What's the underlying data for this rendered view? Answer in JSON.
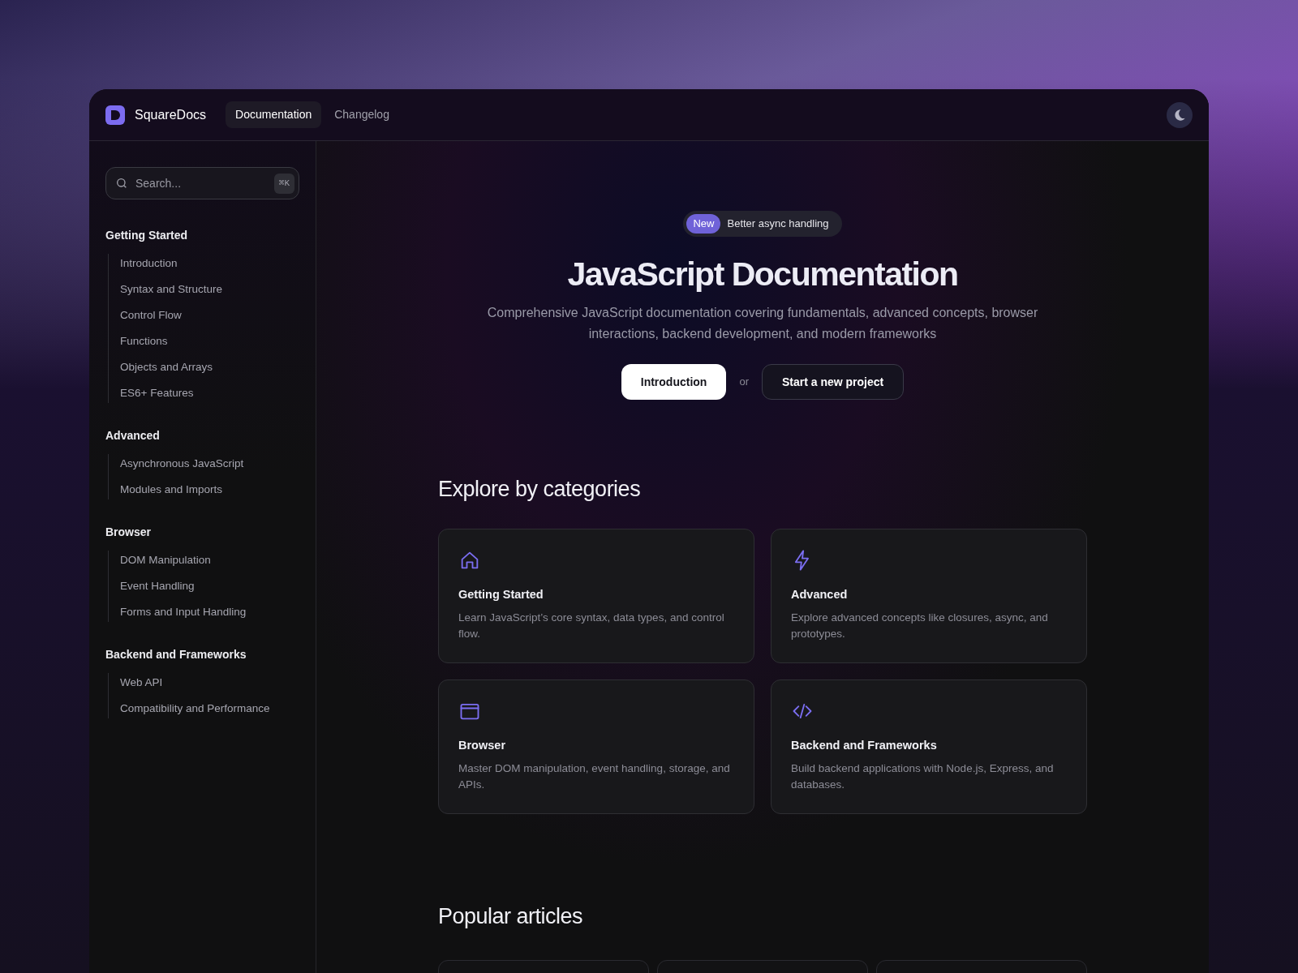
{
  "header": {
    "brand": "SquareDocs",
    "tabs": [
      {
        "label": "Documentation",
        "selected": true
      },
      {
        "label": "Changelog",
        "selected": false
      }
    ]
  },
  "sidebar": {
    "search": {
      "placeholder": "Search...",
      "shortcut": "⌘K"
    },
    "groups": [
      {
        "title": "Getting Started",
        "items": [
          "Introduction",
          "Syntax and Structure",
          "Control Flow",
          "Functions",
          "Objects and Arrays",
          "ES6+ Features"
        ]
      },
      {
        "title": "Advanced",
        "items": [
          "Asynchronous JavaScript",
          "Modules and Imports"
        ]
      },
      {
        "title": "Browser",
        "items": [
          "DOM Manipulation",
          "Event Handling",
          "Forms and Input Handling"
        ]
      },
      {
        "title": "Backend and Frameworks",
        "items": [
          "Web API",
          "Compatibility and Performance"
        ]
      }
    ]
  },
  "hero": {
    "badge": "New",
    "announcement": "Better async handling",
    "title": "JavaScript Documentation",
    "subtitle": "Comprehensive JavaScript documentation covering fundamentals, advanced concepts, browser interactions, backend development, and modern frameworks",
    "primary_button": "Introduction",
    "separator": "or",
    "secondary_button": "Start a new project"
  },
  "categories": {
    "heading": "Explore by categories",
    "cards": [
      {
        "kind": "home",
        "title": "Getting Started",
        "description": "Learn JavaScript’s core syntax, data types, and control flow."
      },
      {
        "kind": "bolt",
        "title": "Advanced",
        "description": "Explore advanced concepts like closures, async, and prototypes."
      },
      {
        "kind": "window",
        "title": "Browser",
        "description": "Master DOM manipulation, event handling, storage, and APIs."
      },
      {
        "kind": "code",
        "title": "Backend and Frameworks",
        "description": "Build backend applications with Node.js, Express, and databases."
      }
    ]
  },
  "popular": {
    "heading": "Popular articles",
    "cards": [
      {
        "kind": "article"
      },
      {
        "kind": "article"
      },
      {
        "kind": "article"
      }
    ]
  }
}
